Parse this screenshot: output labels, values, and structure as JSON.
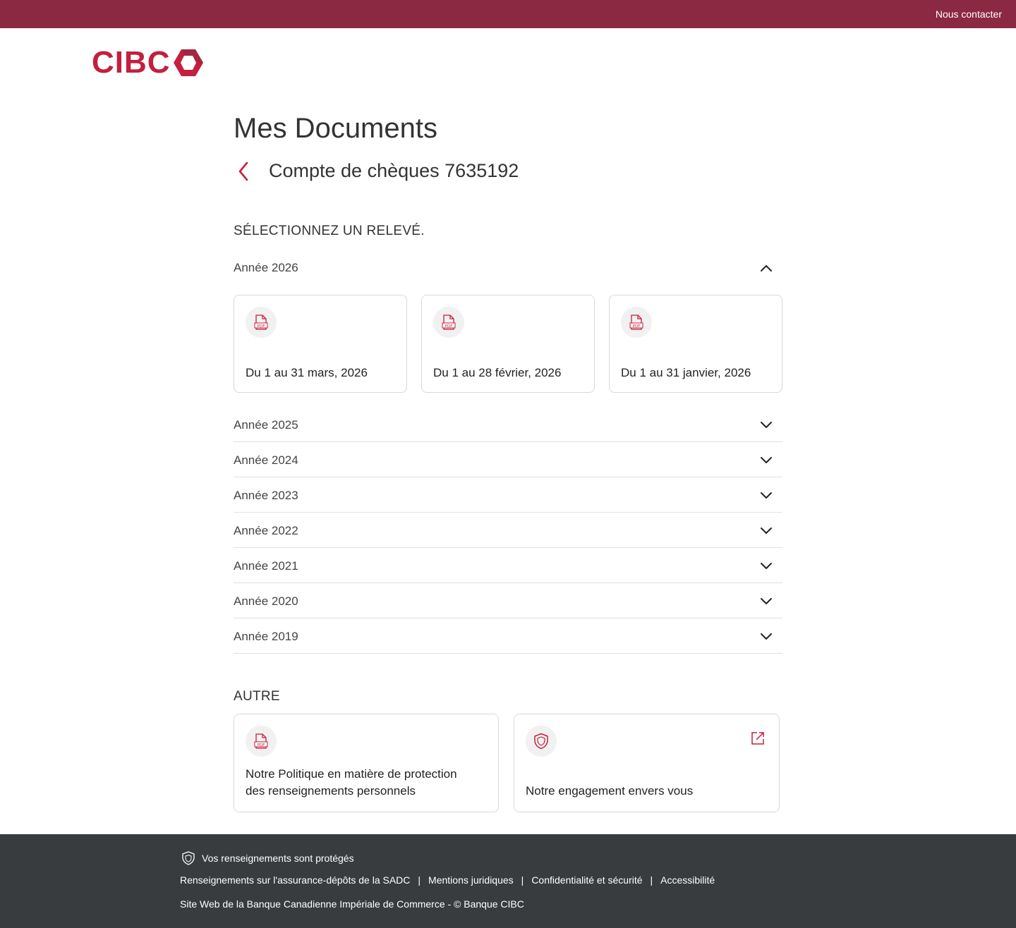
{
  "topbar": {
    "contact_label": "Nous contacter"
  },
  "logo": {
    "text": "CIBC"
  },
  "page": {
    "title": "Mes Documents",
    "account_title": "Compte de chèques 7635192"
  },
  "statements": {
    "section_label": "SÉLECTIONNEZ UN RELEVÉ.",
    "open_year": {
      "label": "Année 2026",
      "documents": [
        {
          "label": "Du 1 au 31 mars, 2026",
          "icon": "pdf-icon"
        },
        {
          "label": "Du 1 au 28 février, 2026",
          "icon": "pdf-icon"
        },
        {
          "label": "Du 1 au 31 janvier, 2026",
          "icon": "pdf-icon"
        }
      ]
    },
    "collapsed_years": [
      {
        "label": "Année 2025"
      },
      {
        "label": "Année 2024"
      },
      {
        "label": "Année 2023"
      },
      {
        "label": "Année 2022"
      },
      {
        "label": "Année 2021"
      },
      {
        "label": "Année 2020"
      },
      {
        "label": "Année 2019"
      }
    ]
  },
  "other": {
    "section_label": "AUTRE",
    "cards": [
      {
        "label": "Notre Politique en matière de protection des renseignements personnels",
        "icon": "pdf-icon"
      },
      {
        "label": "Notre engagement envers vous",
        "icon": "shield-icon",
        "external": "external-link-icon"
      }
    ]
  },
  "footer": {
    "protected_label": "Vos renseignements sont protégés",
    "links": [
      {
        "label": "Renseignements sur l'assurance-dépôts de la SADC"
      },
      {
        "label": "Mentions juridiques"
      },
      {
        "label": "Confidentialité et sécurité"
      },
      {
        "label": "Accessibilité"
      }
    ],
    "copyright": "Site Web de la Banque Canadienne Impériale de Commerce - © Banque CIBC"
  },
  "colors": {
    "brand_red": "#c41f3e",
    "topbar": "#8b2942",
    "footer": "#383c3f"
  }
}
